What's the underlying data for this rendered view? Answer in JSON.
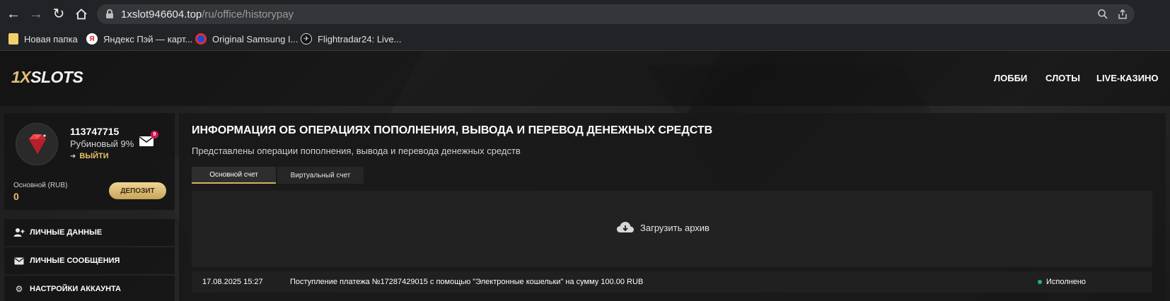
{
  "browser": {
    "url_host": "1xslot946604.top",
    "url_path": "/ru/office/historypay",
    "bookmarks": [
      {
        "label": "Новая папка",
        "icon": "folder-icon"
      },
      {
        "label": "Яндекс Пэй — карт...",
        "icon": "yandex-icon"
      },
      {
        "label": "Original Samsung I...",
        "icon": "samsung-icon"
      },
      {
        "label": "Flightradar24: Live...",
        "icon": "flightradar-icon"
      }
    ]
  },
  "site": {
    "logo_part1": "1X",
    "logo_part2": "SLOTS",
    "nav": [
      "ЛОББИ",
      "СЛОТЫ",
      "LIVE-КАЗИНО"
    ]
  },
  "profile": {
    "user_id": "113747715",
    "level": "Рубиновый 9%",
    "logout_label": "ВЫЙТИ",
    "mail_badge": "9",
    "balance_label": "Основной (RUB)",
    "balance_value": "0",
    "deposit_label": "ДЕПОЗИТ"
  },
  "sidebar_menu": [
    {
      "label": "ЛИЧНЫЕ ДАННЫЕ",
      "icon": "user-plus-icon"
    },
    {
      "label": "ЛИЧНЫЕ СООБЩЕНИЯ",
      "icon": "envelope-icon"
    },
    {
      "label": "НАСТРОЙКИ АККАУНТА",
      "icon": "gears-icon"
    }
  ],
  "main": {
    "title": "ИНФОРМАЦИЯ ОБ ОПЕРАЦИЯХ ПОПОЛНЕНИЯ, ВЫВОДА И ПЕРЕВОД ДЕНЕЖНЫХ СРЕДСТВ",
    "subtitle": "Представлены операции пополнения, вывода и перевода денежных средств",
    "tabs": [
      {
        "label": "Основной счет",
        "active": true
      },
      {
        "label": "Виртуальный счет",
        "active": false
      }
    ],
    "archive_label": "Загрузить архив",
    "transactions": [
      {
        "date": "17.08.2025 15:27",
        "description": "Поступление платежа №17287429015 с помощью \"Электронные кошельки\" на сумму 100.00 RUB",
        "status": "Исполнено",
        "status_color": "#24b47e"
      }
    ]
  },
  "colors": {
    "accent_gold": "#e0bf7b",
    "badge_red": "#d4145a",
    "ruby_red": "#d8343a"
  }
}
